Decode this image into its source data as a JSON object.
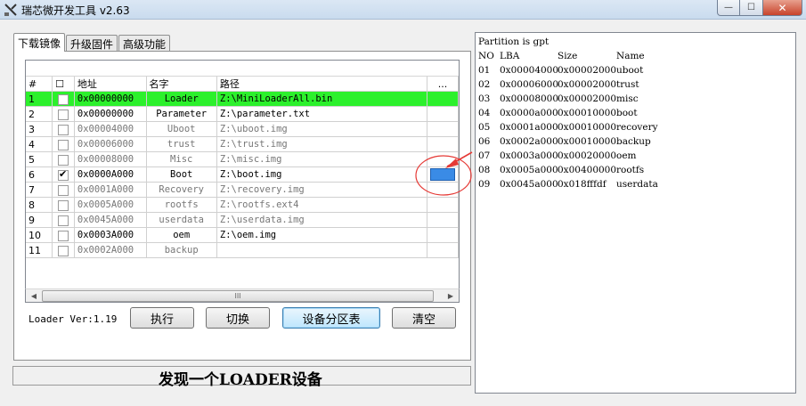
{
  "window": {
    "title": "瑞芯微开发工具 v2.63",
    "buttons": {
      "minimize": "—",
      "maximize": "☐",
      "close": "✕"
    }
  },
  "tabs": [
    {
      "label": "下载镜像",
      "active": true
    },
    {
      "label": "升级固件",
      "active": false
    },
    {
      "label": "高级功能",
      "active": false
    }
  ],
  "grid": {
    "headers": {
      "num": "#",
      "check": "☐",
      "address": "地址",
      "name": "名字",
      "path": "路径",
      "more": "..."
    },
    "rows": [
      {
        "num": "1",
        "checked": false,
        "address": "0x00000000",
        "name": "Loader",
        "path": "Z:\\MiniLoaderAll.bin",
        "highlight": true
      },
      {
        "num": "2",
        "checked": false,
        "address": "0x00000000",
        "name": "Parameter",
        "path": "Z:\\parameter.txt",
        "highlight": false
      },
      {
        "num": "3",
        "checked": false,
        "address": "0x00004000",
        "name": "Uboot",
        "path": "Z:\\uboot.img",
        "highlight": false
      },
      {
        "num": "4",
        "checked": false,
        "address": "0x00006000",
        "name": "trust",
        "path": "Z:\\trust.img",
        "highlight": false
      },
      {
        "num": "5",
        "checked": false,
        "address": "0x00008000",
        "name": "Misc",
        "path": "Z:\\misc.img",
        "highlight": false
      },
      {
        "num": "6",
        "checked": true,
        "address": "0x0000A000",
        "name": "Boot",
        "path": "Z:\\boot.img",
        "highlight": false
      },
      {
        "num": "7",
        "checked": false,
        "address": "0x0001A000",
        "name": "Recovery",
        "path": "Z:\\recovery.img",
        "highlight": false
      },
      {
        "num": "8",
        "checked": false,
        "address": "0x0005A000",
        "name": "rootfs",
        "path": "Z:\\rootfs.ext4",
        "highlight": false
      },
      {
        "num": "9",
        "checked": false,
        "address": "0x0045A000",
        "name": "userdata",
        "path": "Z:\\userdata.img",
        "highlight": false
      },
      {
        "num": "10",
        "checked": false,
        "address": "0x0003A000",
        "name": "oem",
        "path": "Z:\\oem.img",
        "highlight": false
      },
      {
        "num": "11",
        "checked": false,
        "address": "0x0002A000",
        "name": "backup",
        "path": "",
        "highlight": false
      }
    ],
    "scroll_thumb_label": "III"
  },
  "controls": {
    "loader_version": "Loader Ver:1.19",
    "run_button": "执行",
    "switch_button": "切换",
    "partition_button": "设备分区表",
    "clear_button": "清空"
  },
  "status": {
    "text": "发现一个LOADER设备"
  },
  "log": {
    "header": "Partition is gpt",
    "columns": [
      "NO",
      "LBA",
      "Size",
      "Name"
    ],
    "rows": [
      [
        "01",
        "0x00004000",
        "0x00002000",
        "uboot"
      ],
      [
        "02",
        "0x00006000",
        "0x00002000",
        "trust"
      ],
      [
        "03",
        "0x00008000",
        "0x00002000",
        "misc"
      ],
      [
        "04",
        "0x0000a000",
        "0x00010000",
        "boot"
      ],
      [
        "05",
        "0x0001a000",
        "0x00010000",
        "recovery"
      ],
      [
        "06",
        "0x0002a000",
        "0x00010000",
        "backup"
      ],
      [
        "07",
        "0x0003a000",
        "0x00020000",
        "oem"
      ],
      [
        "08",
        "0x0005a000",
        "0x00400000",
        "rootfs"
      ],
      [
        "09",
        "0x0045a000",
        "0x018fffdf",
        "userdata"
      ]
    ]
  },
  "colors": {
    "highlight_row": "#2cf02c",
    "selected_cell": "#3a8be6",
    "annotation": "#e53935"
  }
}
